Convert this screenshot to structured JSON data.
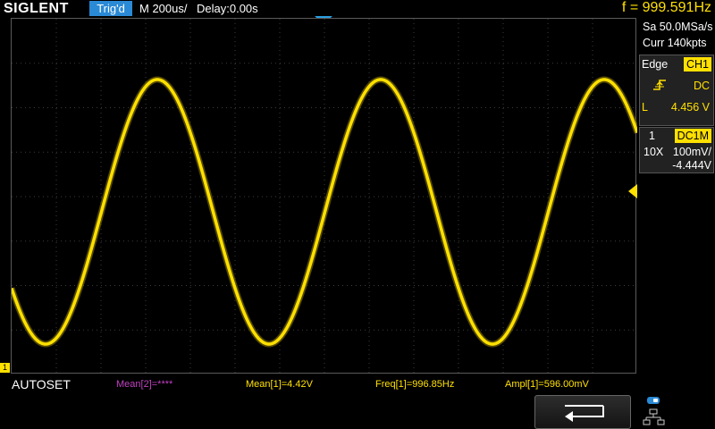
{
  "header": {
    "brand": "SIGLENT",
    "trig_status": "Trig'd",
    "timebase": "M 200us/",
    "delay": "Delay:0.00s",
    "frequency": "f = 999.591Hz"
  },
  "acquisition": {
    "sample_rate": "Sa 50.0MSa/s",
    "memory_depth": "Curr 140kpts"
  },
  "trigger": {
    "type": "Edge",
    "source": "CH1",
    "coupling": "DC",
    "level_prefix": "L",
    "level": "4.456 V"
  },
  "channel": {
    "number": "1",
    "coupling_impedance": "DC1M",
    "probe": "10X",
    "scale": "100mV/",
    "offset": "-4.444V"
  },
  "ground_marker": "1",
  "measurements": {
    "autoset_label": "AUTOSET",
    "items": [
      {
        "text": "Mean[2]=****",
        "color": "#c040c0"
      },
      {
        "text": "Mean[1]=4.42V",
        "color": "#ffe000"
      },
      {
        "text": "Freq[1]=996.85Hz",
        "color": "#ffe000"
      },
      {
        "text": "Ampl[1]=596.00mV",
        "color": "#ffe000"
      }
    ]
  },
  "colors": {
    "ch1": "#ffe000",
    "trigger_status_bg": "#2a8ad6",
    "grid": "#3c3c3c"
  },
  "waveform": {
    "type": "sine",
    "frequency_hz": 999.591,
    "amplitude_v": 0.596,
    "period_divisions": 5
  },
  "icons": {
    "back": "return-arrow-icon",
    "network": "network-icon",
    "trigger_slope": "rising-edge-icon"
  }
}
